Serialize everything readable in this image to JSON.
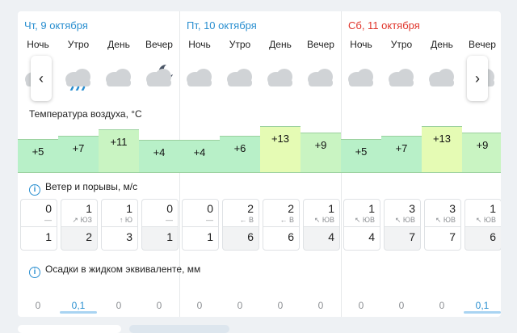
{
  "days": [
    {
      "title": "Чт, 9 октября",
      "weekend": false
    },
    {
      "title": "Пт, 10 октября",
      "weekend": false
    },
    {
      "title": "Сб, 11 октября",
      "weekend": true
    }
  ],
  "parts": [
    "Ночь",
    "Утро",
    "День",
    "Вечер"
  ],
  "icons": [
    [
      "partly-cloudy-night-icon",
      "rain-cloud-icon",
      "cloud-icon",
      "cloudy-moon-icon"
    ],
    [
      "cloud-icon",
      "cloud-icon",
      "cloud-icon",
      "cloud-icon"
    ],
    [
      "cloud-icon",
      "cloud-icon",
      "cloud-icon",
      "cloud-icon"
    ]
  ],
  "temperature": {
    "label": "Температура воздуха, °C",
    "values": [
      [
        "+5",
        "+7",
        "+11",
        "+4"
      ],
      [
        "+4",
        "+6",
        "+13",
        "+9"
      ],
      [
        "+5",
        "+7",
        "+13",
        "+9"
      ]
    ]
  },
  "wind": {
    "label": "Ветер и порывы, м/с",
    "speed": [
      [
        "0",
        "1",
        "1",
        "0"
      ],
      [
        "0",
        "2",
        "2",
        "1"
      ],
      [
        "1",
        "3",
        "3",
        "1"
      ]
    ],
    "direction": [
      [
        "—",
        "↗ ЮЗ",
        "↑ Ю",
        "—"
      ],
      [
        "—",
        "← В",
        "← В",
        "↖ ЮВ"
      ],
      [
        "↖ ЮВ",
        "↖ ЮВ",
        "↖ ЮВ",
        "↖ ЮВ"
      ]
    ],
    "gusts": [
      [
        "1",
        "2",
        "3",
        "1"
      ],
      [
        "1",
        "6",
        "6",
        "4"
      ],
      [
        "4",
        "7",
        "7",
        "6"
      ]
    ]
  },
  "precipitation": {
    "label": "Осадки в жидком эквиваленте, мм",
    "values": [
      [
        "0",
        "0,1",
        "0",
        "0"
      ],
      [
        "0",
        "0",
        "0",
        "0"
      ],
      [
        "0",
        "0",
        "0",
        "0,1"
      ]
    ]
  },
  "nav": {
    "prev": "‹",
    "next": "›"
  },
  "colors": {
    "date": "#2a8fd0",
    "weekend": "#e0352b",
    "temp_low": "#b8f0c8",
    "temp_mid": "#c9f4c2",
    "temp_high": "#e5fbb4"
  }
}
